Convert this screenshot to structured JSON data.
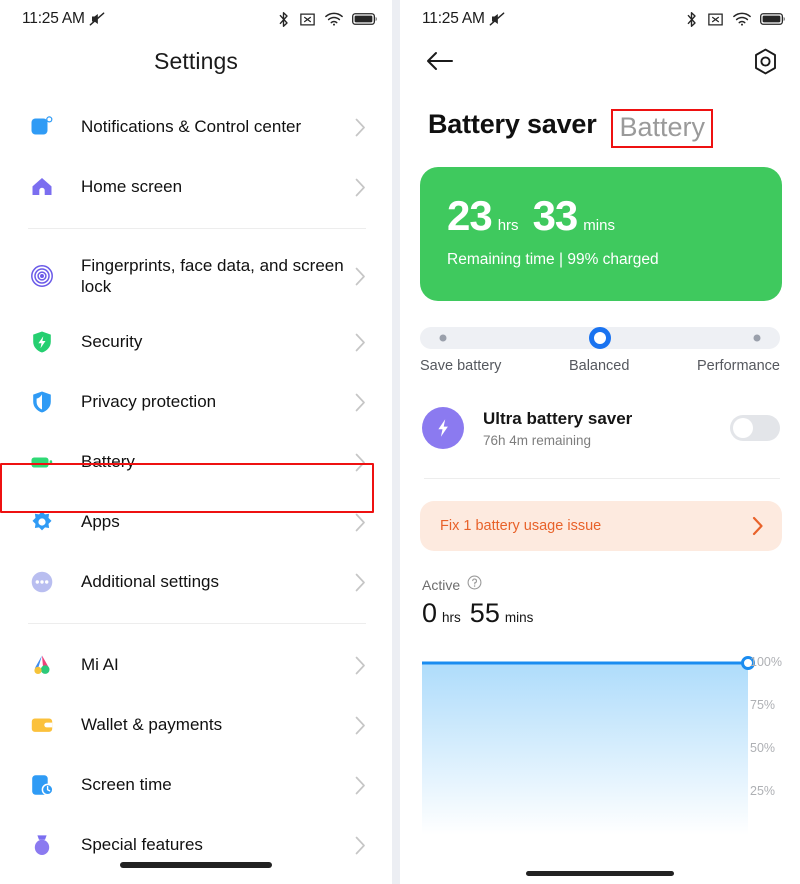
{
  "status_bar": {
    "time": "11:25 AM",
    "icons": [
      "mute-icon",
      "bluetooth-icon",
      "no-sim-icon",
      "wifi-icon",
      "battery-icon"
    ],
    "battery_level_text": "99"
  },
  "left_panel": {
    "title": "Settings",
    "items": [
      {
        "label": "Notifications & Control center",
        "icon": "notifications-icon",
        "name": "notifications-control-center"
      },
      {
        "label": "Home screen",
        "icon": "home-icon",
        "name": "home-screen"
      },
      {
        "label": "Fingerprints, face data, and screen lock",
        "icon": "fingerprint-icon",
        "name": "fingerprints-face-screen-lock"
      },
      {
        "label": "Security",
        "icon": "shield-icon",
        "name": "security"
      },
      {
        "label": "Privacy protection",
        "icon": "privacy-shield-icon",
        "name": "privacy-protection"
      },
      {
        "label": "Battery",
        "icon": "battery-icon",
        "name": "battery"
      },
      {
        "label": "Apps",
        "icon": "apps-gear-icon",
        "name": "apps"
      },
      {
        "label": "Additional settings",
        "icon": "ellipsis-icon",
        "name": "additional-settings"
      },
      {
        "label": "Mi AI",
        "icon": "mi-ai-icon",
        "name": "mi-ai"
      },
      {
        "label": "Wallet & payments",
        "icon": "wallet-icon",
        "name": "wallet-payments"
      },
      {
        "label": "Screen time",
        "icon": "screen-time-icon",
        "name": "screen-time"
      },
      {
        "label": "Special features",
        "icon": "special-features-icon",
        "name": "special-features"
      }
    ],
    "chevron": "chevron-right-icon",
    "highlighted_item": "Battery",
    "highlight_color": "#ee1111"
  },
  "right_panel": {
    "back_icon": "back-arrow-icon",
    "gear_icon": "gear-icon",
    "title": "Battery saver",
    "title_secondary": "Battery",
    "battery_card": {
      "hours": "23",
      "hours_unit": "hrs",
      "minutes": "33",
      "minutes_unit": "mins",
      "subtitle": "Remaining time | 99% charged",
      "background_color": "#3fc95e"
    },
    "mode_selector": {
      "options": [
        "Save battery",
        "Balanced",
        "Performance"
      ],
      "selected": "Balanced",
      "accent_color": "#1a73f0"
    },
    "ultra_saver": {
      "icon": "bolt-icon",
      "title": "Ultra battery saver",
      "subtitle": "76h 4m remaining",
      "toggle_state": "off"
    },
    "fix_banner": {
      "text": "Fix 1 battery usage issue",
      "chevron": "chevron-right-icon",
      "text_color": "#e8622a",
      "background_color": "#fdeadf"
    },
    "active_section": {
      "label": "Active",
      "help_icon": "question-circle-icon",
      "hours": "0",
      "hours_unit": "hrs",
      "minutes": "55",
      "minutes_unit": "mins"
    }
  },
  "chart_data": {
    "type": "area",
    "title": "",
    "xlabel": "",
    "ylabel": "",
    "ylim": [
      0,
      100
    ],
    "yticks": [
      25,
      50,
      75,
      100
    ],
    "ytick_labels": [
      "25%",
      "50%",
      "75%",
      "100%"
    ],
    "grid": true,
    "legend": "none",
    "line_color": "#1a8cf0",
    "fill_color": "#bfe0fb",
    "x": [
      0,
      1
    ],
    "values": [
      100,
      100
    ],
    "marker_point": {
      "x": 1,
      "y": 100,
      "label": "100%"
    }
  }
}
